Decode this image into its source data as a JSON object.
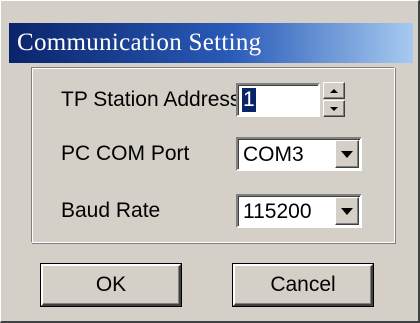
{
  "window": {
    "title": "Communication Setting"
  },
  "fields": {
    "station_address_label": "TP Station Address",
    "station_address_value": "1",
    "com_port_label": "PC COM Port",
    "com_port_value": "COM3",
    "baud_rate_label": "Baud Rate",
    "baud_rate_value": "115200"
  },
  "buttons": {
    "ok_label": "OK",
    "cancel_label": "Cancel"
  },
  "icons": {
    "spin_up": "spin-up-arrow-icon",
    "spin_down": "spin-down-arrow-icon",
    "dropdown": "chevron-down-icon"
  },
  "colors": {
    "title_start": "#0a246a",
    "title_end": "#a6caf0",
    "face": "#d4d0c8",
    "selection": "#0a246a"
  }
}
